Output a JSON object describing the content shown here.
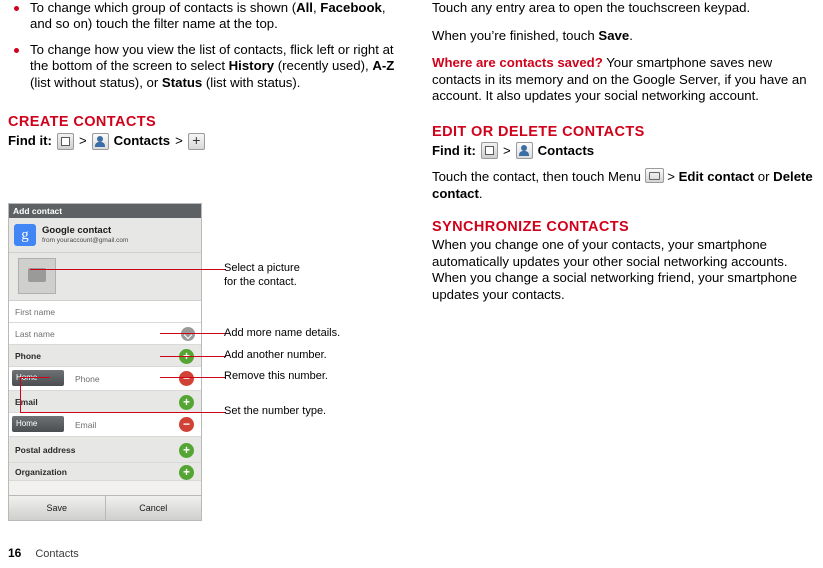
{
  "left_column": {
    "bullets": [
      {
        "parts": [
          {
            "t": "To change which group of contacts is shown (",
            "b": false
          },
          {
            "t": "All",
            "b": true
          },
          {
            "t": ", ",
            "b": false
          },
          {
            "t": "Facebook",
            "b": true
          },
          {
            "t": ", and so on) touch the filter name at the top.",
            "b": false
          }
        ]
      },
      {
        "parts": [
          {
            "t": "To change how you view the list of contacts, flick left or right at the bottom of the screen to select ",
            "b": false
          },
          {
            "t": "History",
            "b": true
          },
          {
            "t": " (recently used), ",
            "b": false
          },
          {
            "t": "A-Z",
            "b": true
          },
          {
            "t": " (list without status), or ",
            "b": false
          },
          {
            "t": "Status",
            "b": true
          },
          {
            "t": " (list with status).",
            "b": false
          }
        ]
      }
    ],
    "section_heading": "CREATE CONTACTS",
    "find_it_label": "Find it:",
    "find_it_sep": ">",
    "find_it_contacts": "Contacts",
    "icons": {
      "launcher": "launcher-icon",
      "contacts": "contacts-icon",
      "plus": "plus-icon"
    }
  },
  "figure": {
    "title_bar": "Add contact",
    "account_name": "Google contact",
    "account_sub": "from youraccount@gmail.com",
    "fields": [
      {
        "label": "First name",
        "type": "input"
      },
      {
        "label": "Last name",
        "type": "input-chevron"
      },
      {
        "label": "Phone",
        "type": "section-add"
      },
      {
        "label": "Phone",
        "type": "typed-remove",
        "type_label": "Home"
      },
      {
        "label": "Email",
        "type": "section-add"
      },
      {
        "label": "Email",
        "type": "typed-remove",
        "type_label": "Home"
      },
      {
        "label": "Postal address",
        "type": "section-add"
      },
      {
        "label": "Organization",
        "type": "section-add"
      }
    ],
    "buttons": {
      "save": "Save",
      "cancel": "Cancel"
    },
    "callouts": [
      {
        "text": "Select a picture\nfor the contact."
      },
      {
        "text": "Add more name details."
      },
      {
        "text": "Add another number."
      },
      {
        "text": "Remove this number."
      },
      {
        "text": "Set the number type."
      }
    ]
  },
  "right_column": {
    "intro1": "Touch any entry area to open the touchscreen keypad.",
    "intro2_parts": [
      {
        "t": "When you’re finished, touch ",
        "b": false
      },
      {
        "t": "Save",
        "b": true
      },
      {
        "t": ".",
        "b": false
      }
    ],
    "saved_q": "Where are contacts saved?",
    "saved_a": " Your smartphone saves new contacts in its memory and on the Google Server, if you have an account. It also updates your social networking account.",
    "edit_heading": "EDIT OR DELETE CONTACTS",
    "edit_find_label": "Find it:",
    "edit_find_sep": ">",
    "edit_find_contacts": "Contacts",
    "edit_body_parts": [
      {
        "t": "Touch the contact, then touch Menu ",
        "b": false
      },
      {
        "t": "MENU_ICON",
        "b": false
      },
      {
        "t": " > ",
        "b": false
      },
      {
        "t": "Edit contact",
        "b": true
      },
      {
        "t": " or ",
        "b": false
      },
      {
        "t": "Delete contact",
        "b": true
      },
      {
        "t": ".",
        "b": false
      }
    ],
    "sync_heading": "SYNCHRONIZE CONTACTS",
    "sync_body": "When you change one of your contacts, your smartphone automatically updates your other social networking accounts. When you change a social networking friend, your smartphone updates your contacts."
  },
  "footer": {
    "page_number": "16",
    "section": "Contacts"
  },
  "colors": {
    "accent_red": "#d0021b",
    "add_green": "#54a534",
    "remove_red": "#d14236"
  }
}
